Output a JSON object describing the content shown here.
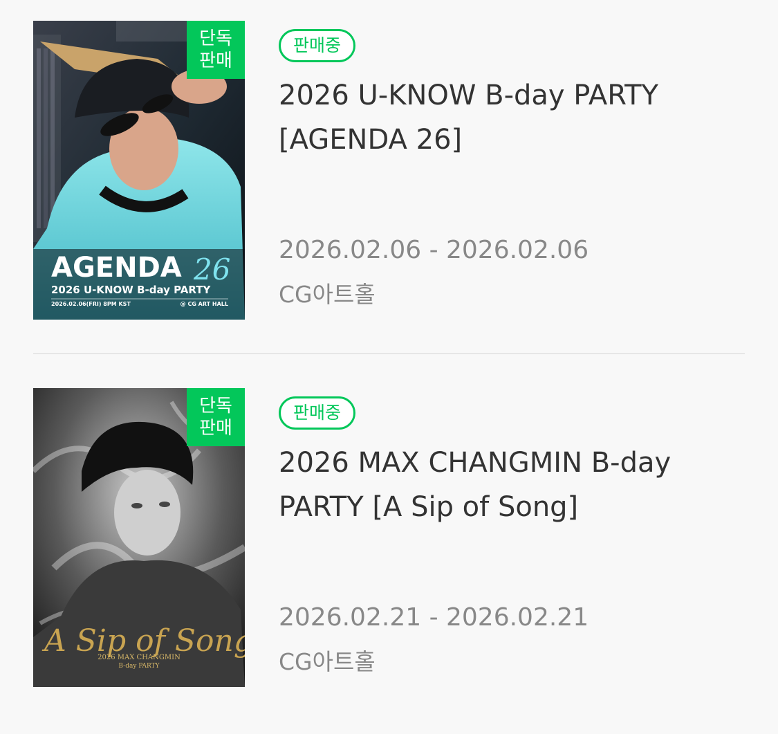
{
  "colors": {
    "accent": "#03c75a",
    "title": "#333333",
    "meta": "#888888",
    "background": "#f8f8f8"
  },
  "items": [
    {
      "exclusive_badge": [
        "단독",
        "판매"
      ],
      "status": "판매중",
      "title": "2026 U-KNOW B-day PARTY [AGENDA 26]",
      "dates": "2026.02.06 - 2026.02.06",
      "venue": "CG아트홀",
      "poster": {
        "headline": "AGENDA",
        "headline_suffix": "26",
        "subtitle": "2026 U-KNOW B-day PARTY",
        "footer_left": "2026.02.06(FRI) 8PM KST",
        "footer_right": "@ CG ART HALL"
      }
    },
    {
      "exclusive_badge": [
        "단독",
        "판매"
      ],
      "status": "판매중",
      "title": "2026 MAX CHANGMIN B-day PARTY [A Sip of Song]",
      "dates": "2026.02.21 - 2026.02.21",
      "venue": "CG아트홀",
      "poster": {
        "headline": "A Sip of Song",
        "subtitle": "2026 MAX CHANGMIN",
        "subtitle2": "B-day PARTY"
      }
    }
  ]
}
